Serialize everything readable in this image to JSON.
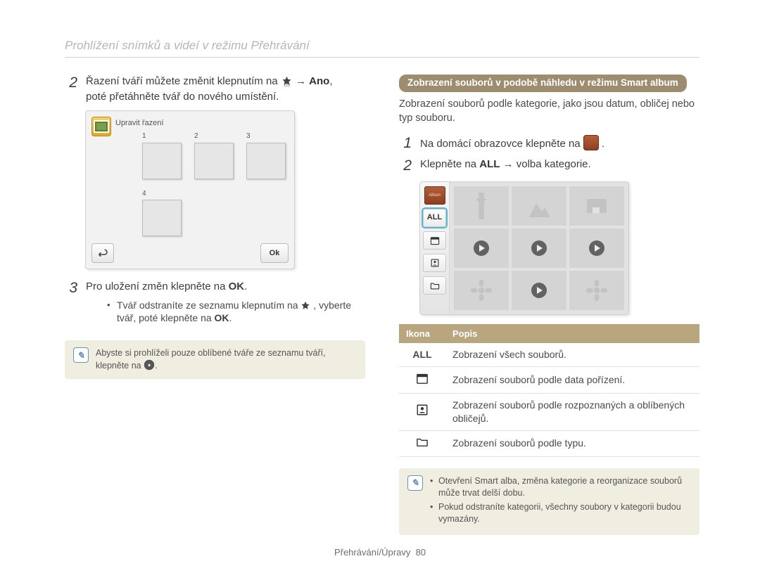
{
  "page_title": "Prohlížení snímků a videí v režimu Přehrávání",
  "left": {
    "step2_line1_pre": "Řazení tváří můžete změnit klepnutím na ",
    "step2_line1_post": " → ",
    "step2_line1_bold": "Ano",
    "step2_line1_comma": ",",
    "step2_line2": "poté přetáhněte tvář do nového umístění.",
    "screen_title": "Upravit řazení",
    "faces": [
      "1",
      "2",
      "3",
      "4"
    ],
    "ok_button": "Ok",
    "step3_pre": "Pro uložení změn klepněte na ",
    "step3_post": ".",
    "bullets": [
      {
        "pre": "Tvář odstraníte ze seznamu klepnutím na ",
        "mid": ", vyberte tvář, poté klepněte na ",
        "end": ".",
        "icon": "star"
      }
    ],
    "note": "Abyste si prohlíželi pouze oblíbené tváře ze seznamu tváří, klepněte na "
  },
  "right": {
    "heading": "Zobrazení souborů v podobě náhledu v režimu Smart album",
    "intro": "Zobrazení souborů podle kategorie, jako jsou datum, obličej nebo typ souboru.",
    "step1": "Na domácí obrazovce klepněte na ",
    "step1_end": ".",
    "step2_pre": "Klepněte na ",
    "step2_all": "ALL",
    "step2_post": " → volba kategorie.",
    "sidebar_all": "ALL",
    "table": {
      "h_icon": "Ikona",
      "h_desc": "Popis",
      "rows": [
        {
          "icon": "ALL",
          "desc": "Zobrazení všech souborů."
        },
        {
          "icon": "calendar",
          "desc": "Zobrazení souborů podle data pořízení."
        },
        {
          "icon": "face",
          "desc": "Zobrazení souborů podle rozpoznaných a oblíbených obličejů."
        },
        {
          "icon": "folder",
          "desc": "Zobrazení souborů podle typu."
        }
      ]
    },
    "notes": [
      "Otevření Smart alba, změna kategorie a reorganizace souborů může trvat delší dobu.",
      "Pokud odstraníte kategorii, všechny soubory v kategorii budou vymazány."
    ]
  },
  "footer": {
    "section": "Přehrávání/Úpravy",
    "page": "80"
  },
  "numbers": {
    "n1": "1",
    "n2": "2",
    "n3": "3"
  }
}
